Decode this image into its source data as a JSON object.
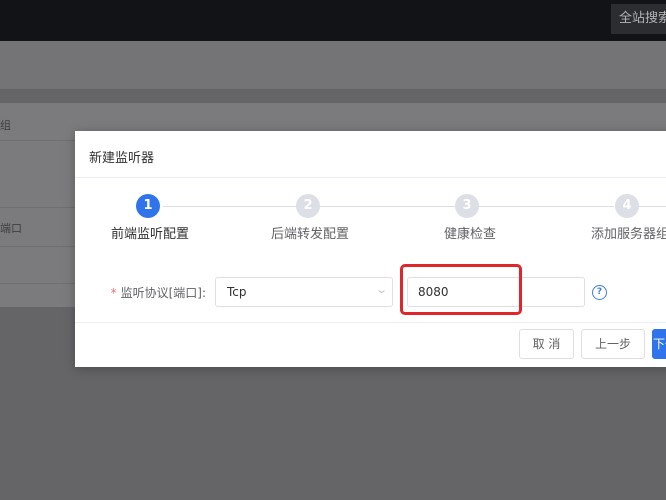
{
  "topbar": {
    "global_search_label": "全站搜索"
  },
  "background": {
    "column_header_fragment": "组",
    "cell_fragment": "端口"
  },
  "modal": {
    "title": "新建监听器",
    "steps": [
      {
        "number": "1",
        "label": "前端监听配置",
        "state": "active"
      },
      {
        "number": "2",
        "label": "后端转发配置",
        "state": "pending"
      },
      {
        "number": "3",
        "label": "健康检查",
        "state": "pending"
      },
      {
        "number": "4",
        "label": "添加服务器组",
        "state": "pending"
      }
    ],
    "form": {
      "required_mark": "*",
      "protocol_label": "监听协议[端口]:",
      "protocol_value": "Tcp",
      "port_value": "8080",
      "help_glyph": "?"
    },
    "buttons": {
      "cancel": "取 消",
      "prev": "上一步",
      "next": "下一步"
    }
  },
  "colors": {
    "accent": "#2f74ea",
    "highlight": "#e0262b",
    "required": "#f56c6c"
  }
}
